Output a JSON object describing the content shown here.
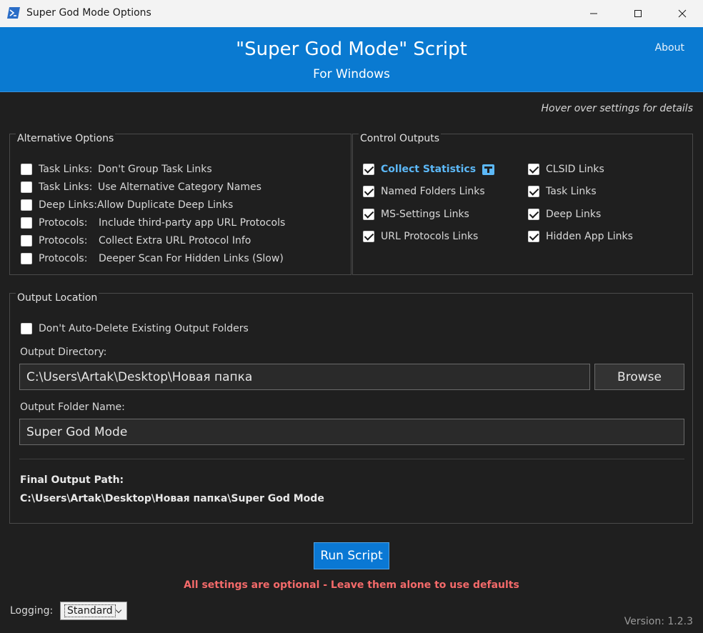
{
  "window": {
    "title": "Super God Mode Options"
  },
  "header": {
    "title": "\"Super God Mode\" Script",
    "subtitle": "For Windows",
    "about": "About"
  },
  "hint": "Hover over settings for details",
  "alternative_options": {
    "legend": "Alternative Options",
    "items": [
      {
        "prefix": "Task Links:",
        "text": "Don't Group Task Links",
        "checked": false
      },
      {
        "prefix": "Task Links:",
        "text": "Use Alternative Category Names",
        "checked": false
      },
      {
        "prefix": "Deep Links:",
        "text": "Allow Duplicate Deep Links",
        "checked": false
      },
      {
        "prefix": "Protocols:",
        "text": "Include third-party app URL Protocols",
        "checked": false
      },
      {
        "prefix": "Protocols:",
        "text": "Collect Extra URL Protocol Info",
        "checked": false
      },
      {
        "prefix": "Protocols:",
        "text": "Deeper Scan For Hidden Links (Slow)",
        "checked": false
      }
    ]
  },
  "control_outputs": {
    "legend": "Control Outputs",
    "left": [
      {
        "label": "Collect Statistics",
        "checked": true,
        "accent": true
      },
      {
        "label": "Named Folders Links",
        "checked": true
      },
      {
        "label": "MS-Settings Links",
        "checked": true
      },
      {
        "label": "URL Protocols Links",
        "checked": true
      }
    ],
    "right": [
      {
        "label": "CLSID Links",
        "checked": true
      },
      {
        "label": "Task Links",
        "checked": true
      },
      {
        "label": "Deep Links",
        "checked": true
      },
      {
        "label": "Hidden App Links",
        "checked": true
      }
    ],
    "accent_color": "#5cb8f7"
  },
  "output_location": {
    "legend": "Output Location",
    "no_delete": {
      "label": "Don't Auto-Delete Existing Output Folders",
      "checked": false
    },
    "dir_label": "Output Directory:",
    "dir_value": "C:\\Users\\Artak\\Desktop\\Новая папка",
    "browse": "Browse",
    "name_label": "Output Folder Name:",
    "name_value": "Super God Mode",
    "final_label": "Final Output Path:",
    "final_value": "C:\\Users\\Artak\\Desktop\\Новая папка\\Super God Mode"
  },
  "run_button": "Run Script",
  "warning": "All settings are optional - Leave them alone to use defaults",
  "logging": {
    "label": "Logging:",
    "value": "Standard"
  },
  "version": "Version: 1.2.3",
  "colors": {
    "banner": "#0a7ad1",
    "background": "#1f1f1f",
    "warning": "#f46a6a",
    "button": "#0a78d4"
  }
}
